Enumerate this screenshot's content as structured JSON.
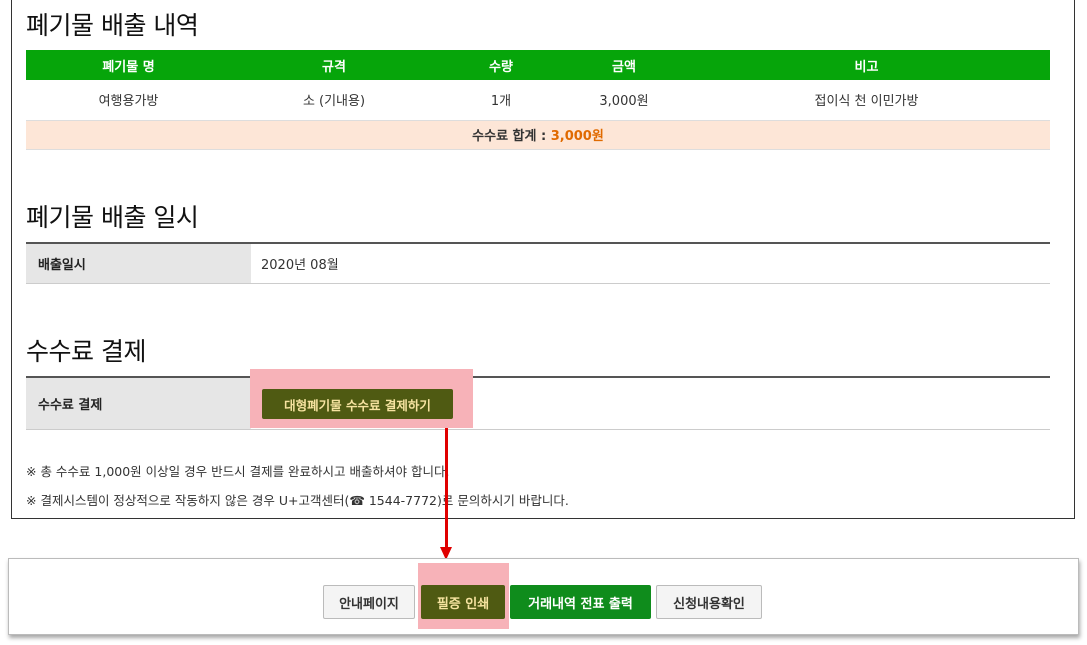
{
  "sections": {
    "waste_history_title": "폐기물 배출 내역",
    "waste_date_title": "폐기물 배출 일시",
    "fee_payment_title": "수수료 결제"
  },
  "waste_table": {
    "headers": [
      "폐기물 명",
      "규격",
      "수량",
      "금액",
      "비고"
    ],
    "rows": [
      [
        "여행용가방",
        "소 (기내용)",
        "1개",
        "3,000원",
        "접이식 천 이민가방"
      ]
    ],
    "sum_label": "수수료 합계 : ",
    "sum_value": "3,000원"
  },
  "emission_date": {
    "label": "배출일시",
    "value": "2020년 08월"
  },
  "fee_payment": {
    "label": "수수료 결제",
    "button_label": "대형폐기물 수수료 결제하기"
  },
  "notes": [
    "※ 총 수수료 1,000원 이상일 경우 반드시 결제를 완료하시고 배출하셔야 합니다.",
    "※ 결제시스템이 정상적으로 작동하지 않은 경우 U+고객센터(☎ 1544-7772)로 문의하시기 바랍니다."
  ],
  "bottom_bar": {
    "guide_button": "안내페이지",
    "print_receipt_button": "필증 인쇄",
    "transaction_button": "거래내역 전표 출력",
    "confirm_button": "신청내용확인"
  },
  "colors": {
    "header_green": "#06a50a",
    "olive_button": "#4f5a12",
    "highlight": "#f7b2b8",
    "arrow": "#e00000",
    "sum_bg": "#fde6d7"
  }
}
